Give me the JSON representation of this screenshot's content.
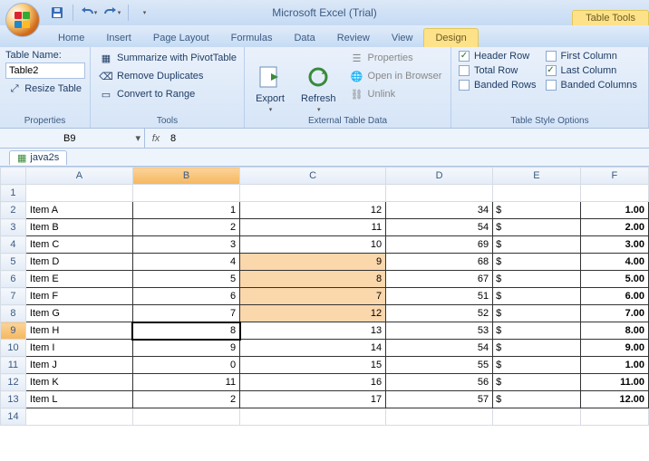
{
  "app": {
    "title": "Microsoft Excel (Trial)",
    "tabletools": "Table Tools"
  },
  "tabs": {
    "home": "Home",
    "insert": "Insert",
    "pagelayout": "Page Layout",
    "formulas": "Formulas",
    "data": "Data",
    "review": "Review",
    "view": "View",
    "design": "Design"
  },
  "ribbon": {
    "properties": {
      "label": "Properties",
      "tablename_lbl": "Table Name:",
      "tablename_val": "Table2",
      "resize": "Resize Table"
    },
    "tools": {
      "label": "Tools",
      "pivot": "Summarize with PivotTable",
      "dup": "Remove Duplicates",
      "range": "Convert to Range"
    },
    "ext": {
      "label": "External Table Data",
      "export": "Export",
      "refresh": "Refresh",
      "props": "Properties",
      "browser": "Open in Browser",
      "unlink": "Unlink"
    },
    "style": {
      "label": "Table Style Options",
      "header": "Header Row",
      "total": "Total Row",
      "banded_r": "Banded Rows",
      "first": "First Column",
      "last": "Last Column",
      "banded_c": "Banded Columns"
    }
  },
  "namebox": "B9",
  "formula": "8",
  "doc": "java2s",
  "cols": [
    "A",
    "B",
    "C",
    "D",
    "E",
    "F"
  ],
  "rows": [
    {
      "n": 1
    },
    {
      "n": 2,
      "a": "Item A",
      "b": "1",
      "c": "12",
      "d": "34",
      "cur": "$",
      "e": "1.00"
    },
    {
      "n": 3,
      "a": "Item B",
      "b": "2",
      "c": "11",
      "d": "54",
      "cur": "$",
      "e": "2.00"
    },
    {
      "n": 4,
      "a": "Item C",
      "b": "3",
      "c": "10",
      "d": "69",
      "cur": "$",
      "e": "3.00"
    },
    {
      "n": 5,
      "a": "Item D",
      "b": "4",
      "c": "9",
      "d": "68",
      "cur": "$",
      "e": "4.00",
      "hlc": true
    },
    {
      "n": 6,
      "a": "Item E",
      "b": "5",
      "c": "8",
      "d": "67",
      "cur": "$",
      "e": "5.00",
      "hlc": true
    },
    {
      "n": 7,
      "a": "Item F",
      "b": "6",
      "c": "7",
      "d": "51",
      "cur": "$",
      "e": "6.00",
      "hlc": true
    },
    {
      "n": 8,
      "a": "Item G",
      "b": "7",
      "c": "12",
      "d": "52",
      "cur": "$",
      "e": "7.00",
      "hlc": true
    },
    {
      "n": 9,
      "a": "Item H",
      "b": "8",
      "c": "13",
      "d": "53",
      "cur": "$",
      "e": "8.00",
      "sel": true,
      "hlrow": true
    },
    {
      "n": 10,
      "a": "Item I",
      "b": "9",
      "c": "14",
      "d": "54",
      "cur": "$",
      "e": "9.00"
    },
    {
      "n": 11,
      "a": "Item J",
      "b": "0",
      "c": "15",
      "d": "55",
      "cur": "$",
      "e": "1.00"
    },
    {
      "n": 12,
      "a": "Item K",
      "b": "11",
      "c": "16",
      "d": "56",
      "cur": "$",
      "e": "11.00"
    },
    {
      "n": 13,
      "a": "Item L",
      "b": "2",
      "c": "17",
      "d": "57",
      "cur": "$",
      "e": "12.00"
    },
    {
      "n": 14
    }
  ]
}
